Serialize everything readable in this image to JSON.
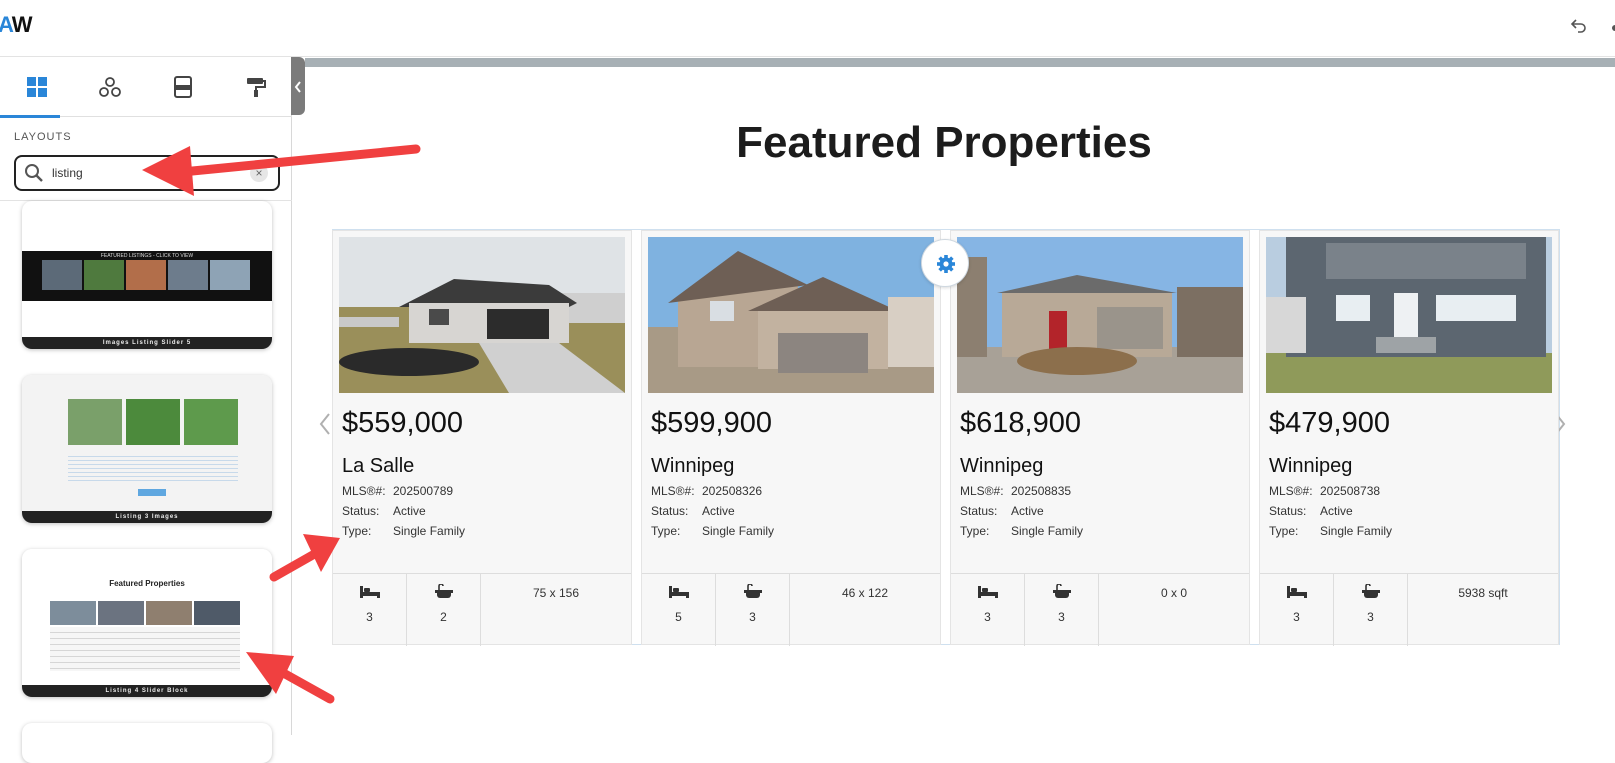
{
  "app": {
    "logo_a": "A",
    "logo_w": "W"
  },
  "sidebar": {
    "tabs": [
      {
        "name": "layouts",
        "icon": "grid-icon"
      },
      {
        "name": "elements",
        "icon": "nodes-icon"
      },
      {
        "name": "blocks",
        "icon": "blocks-icon"
      },
      {
        "name": "style",
        "icon": "paint-roller-icon"
      }
    ],
    "section_label": "LAYOUTS",
    "search": {
      "value": "listing",
      "clear": "×"
    },
    "layouts": [
      {
        "caption": "Images Listing Slider 5",
        "header": "FEATURED LISTINGS - CLICK TO VIEW"
      },
      {
        "caption": "Listing 3 Images"
      },
      {
        "caption": "Listing 4 Slider Block",
        "header": "Featured Properties"
      }
    ]
  },
  "page": {
    "title": "Featured Properties"
  },
  "colors": {
    "accent": "#2a86d8",
    "annotation": "#f04040"
  },
  "listings": [
    {
      "price": "$559,000",
      "city": "La Salle",
      "mls_label": "MLS®#:",
      "mls": "202500789",
      "status_label": "Status:",
      "status": "Active",
      "type_label": "Type:",
      "type": "Single Family",
      "beds": "3",
      "baths": "2",
      "lot": "75 x 156"
    },
    {
      "price": "$599,900",
      "city": "Winnipeg",
      "mls_label": "MLS®#:",
      "mls": "202508326",
      "status_label": "Status:",
      "status": "Active",
      "type_label": "Type:",
      "type": "Single Family",
      "beds": "5",
      "baths": "3",
      "lot": "46 x 122"
    },
    {
      "price": "$618,900",
      "city": "Winnipeg",
      "mls_label": "MLS®#:",
      "mls": "202508835",
      "status_label": "Status:",
      "status": "Active",
      "type_label": "Type:",
      "type": "Single Family",
      "beds": "3",
      "baths": "3",
      "lot": "0 x 0"
    },
    {
      "price": "$479,900",
      "city": "Winnipeg",
      "mls_label": "MLS®#:",
      "mls": "202508738",
      "status_label": "Status:",
      "status": "Active",
      "type_label": "Type:",
      "type": "Single Family",
      "beds": "3",
      "baths": "3",
      "lot": "5938 sqft"
    }
  ]
}
